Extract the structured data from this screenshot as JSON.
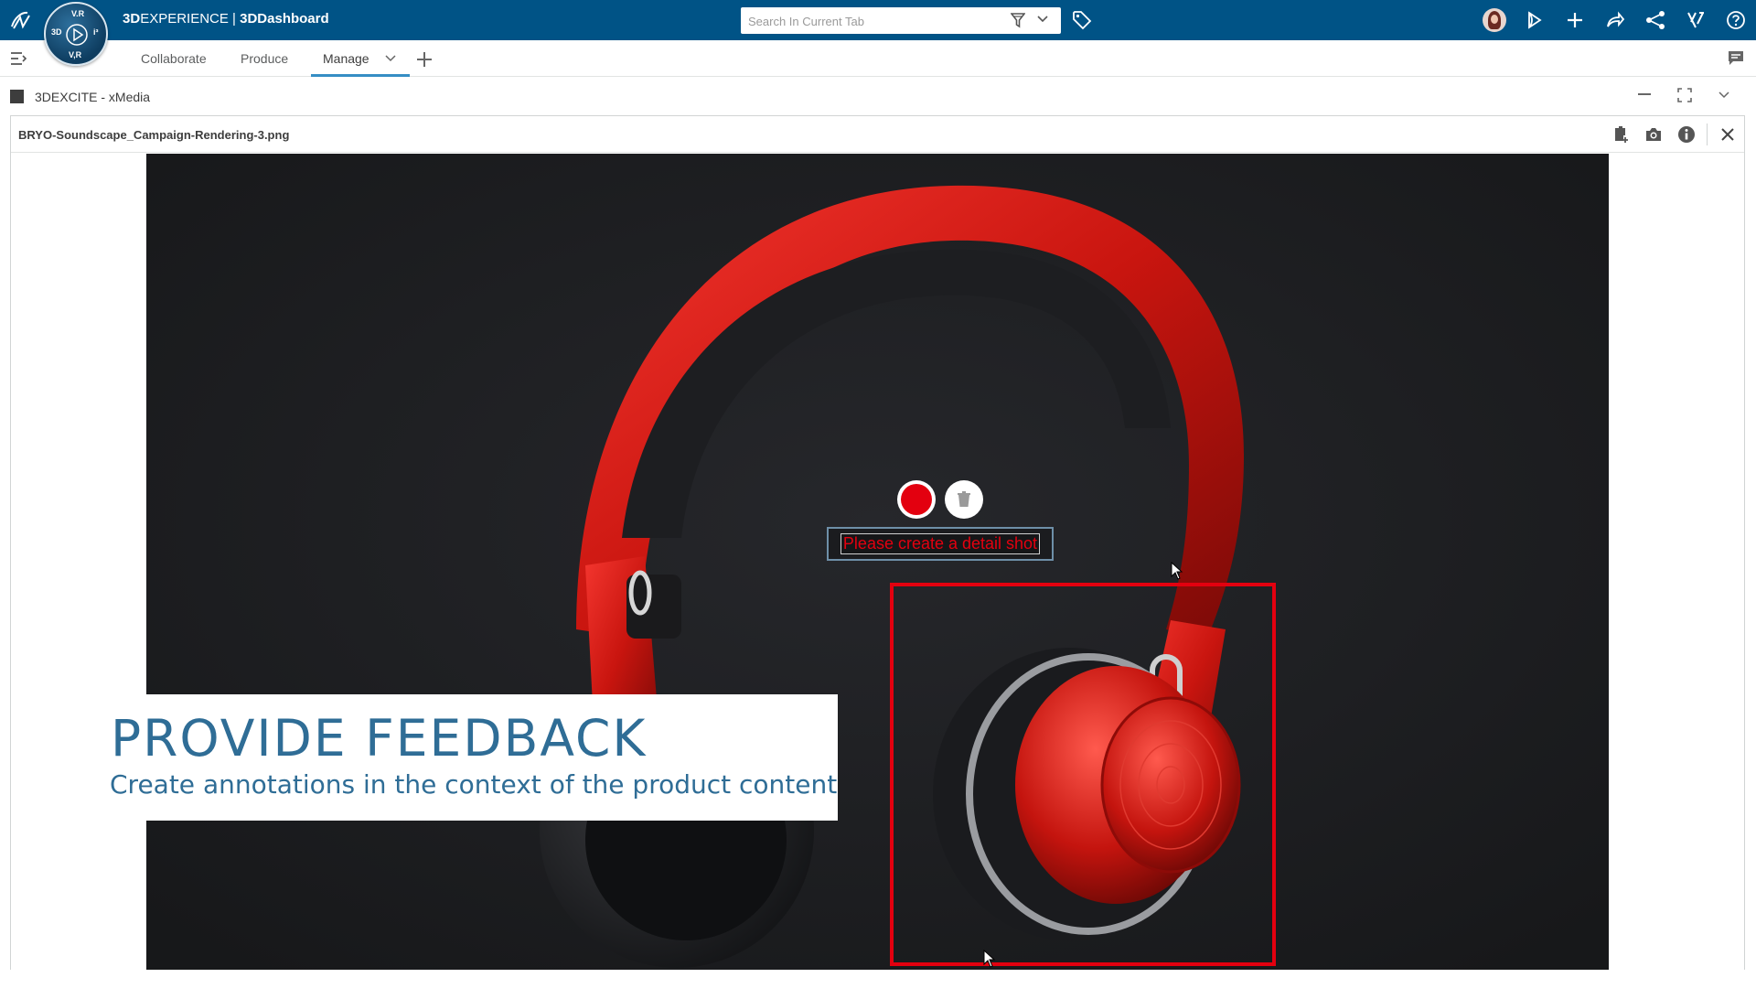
{
  "header": {
    "brand_prefix": "3D",
    "brand_main": "EXPERIENCE | ",
    "brand_app": "3DDashboard",
    "compass": {
      "top": "V.R",
      "left": "3D",
      "bottom": "V,R",
      "right": "i³"
    },
    "search": {
      "placeholder": "Search In Current Tab",
      "value": ""
    },
    "icons": [
      "ds-logo-icon",
      "filter-icon",
      "tag-icon",
      "avatar",
      "share-icon",
      "plus-icon",
      "forward-icon",
      "network-icon",
      "apps-icon",
      "help-icon"
    ]
  },
  "tabs": {
    "items": [
      {
        "label": "Collaborate"
      },
      {
        "label": "Produce"
      },
      {
        "label": "Manage"
      }
    ],
    "active": "Manage"
  },
  "widget": {
    "title": "3DEXCITE - xMedia"
  },
  "viewer": {
    "file_name": "BRYO-Soundscape_Campaign-Rendering-3.png"
  },
  "annotation": {
    "text": "Please create a detail shot",
    "color": "#e3000f"
  },
  "overlay": {
    "title": "PROVIDE FEEDBACK",
    "subtitle": "Create annotations in the context of the product content"
  },
  "colors": {
    "topbar": "#005386",
    "accent": "#368ec4",
    "annotation_red": "#e3000f",
    "overlay_text": "#2f6d96",
    "canvas_bg": "#1b1c1f"
  }
}
